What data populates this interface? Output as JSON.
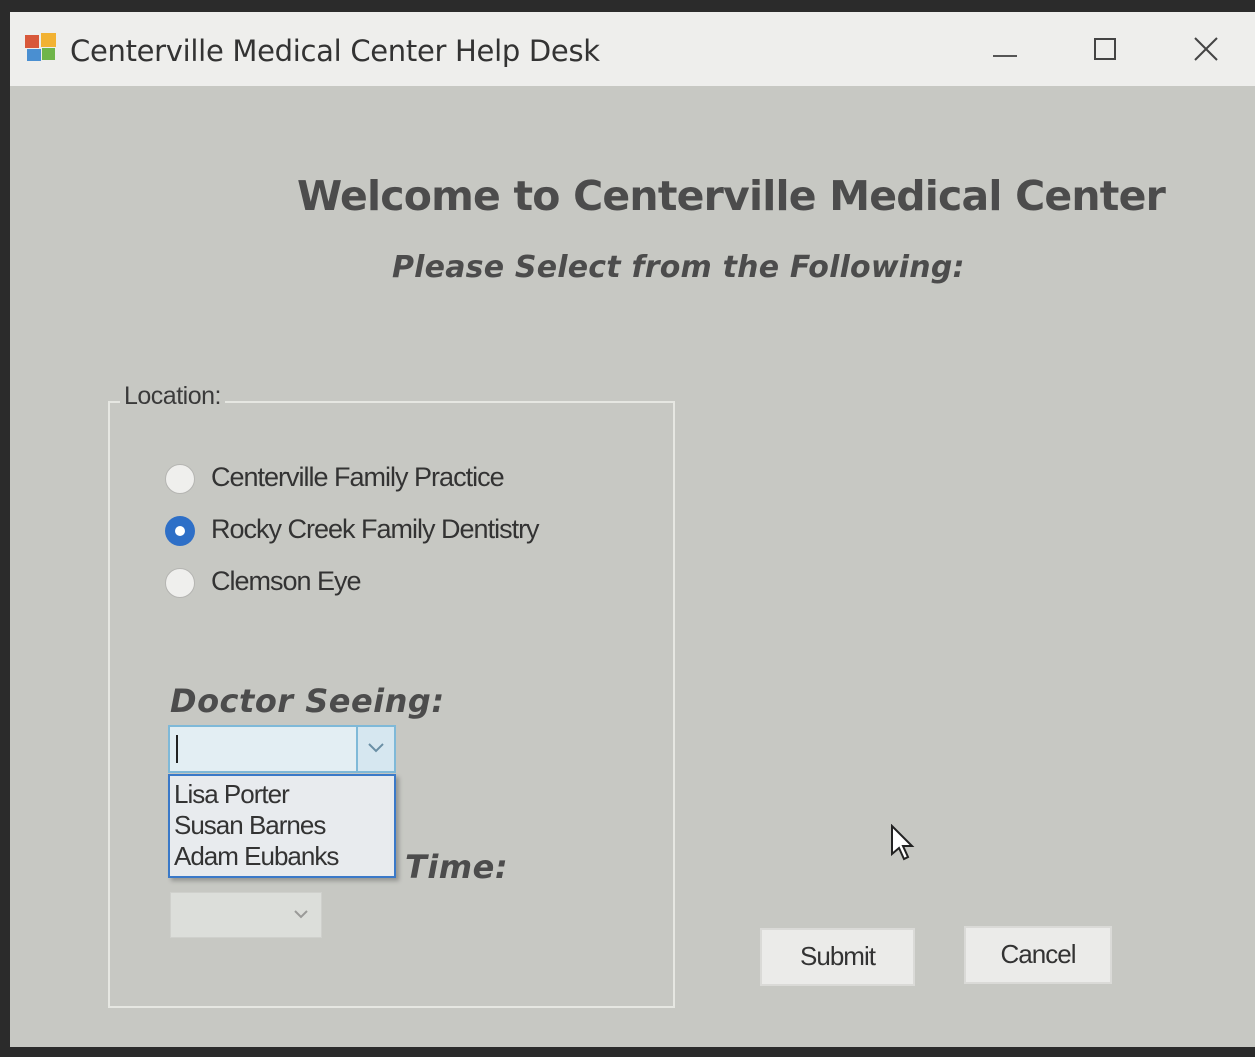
{
  "window": {
    "title": "Centerville Medical Center Help Desk",
    "controls": [
      "minimize",
      "maximize",
      "close"
    ]
  },
  "header": {
    "title": "Welcome to Centerville Medical Center",
    "subtitle": "Please Select from the Following:"
  },
  "location": {
    "legend": "Location:",
    "options": [
      {
        "label": "Centerville Family Practice",
        "checked": false
      },
      {
        "label": "Rocky Creek Family Dentistry",
        "checked": true
      },
      {
        "label": "Clemson Eye",
        "checked": false
      }
    ]
  },
  "doctor": {
    "label": "Doctor Seeing:",
    "value": "",
    "dropdown_open": true,
    "options": [
      "Lisa Porter",
      "Susan Barnes",
      "Adam Eubanks"
    ]
  },
  "appointment": {
    "label_visible": "Time:",
    "value": ""
  },
  "buttons": {
    "submit": "Submit",
    "cancel": "Cancel"
  },
  "colors": {
    "window_bg": "#c7c8c3",
    "accent": "#2e6fc7",
    "focus_border": "#7fb9d8"
  },
  "icons": {
    "app": "app-window-icon",
    "cursor": "mouse-pointer-icon"
  }
}
